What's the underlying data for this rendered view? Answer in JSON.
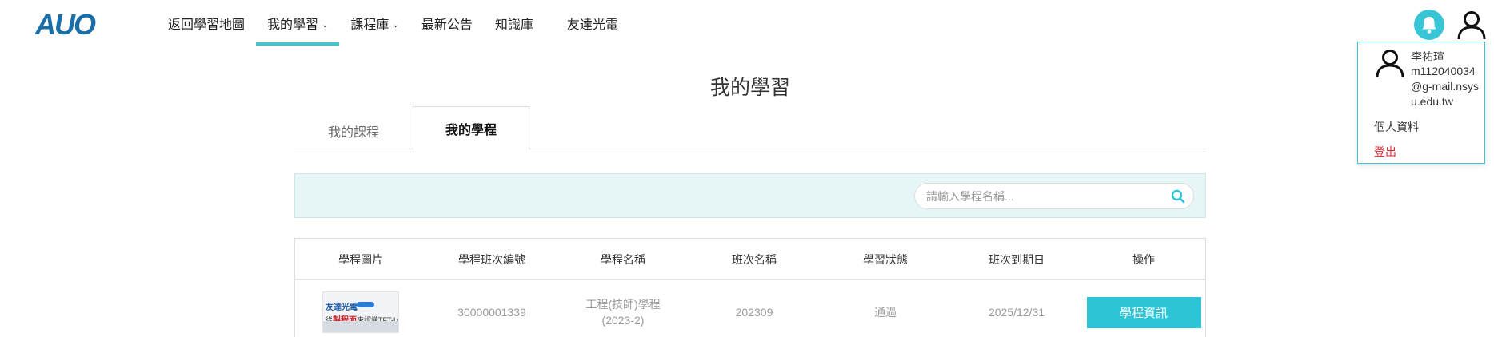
{
  "header": {
    "logo_text": "AUO",
    "nav": [
      {
        "label": "返回學習地圖",
        "has_dropdown": false,
        "active": false
      },
      {
        "label": "我的學習",
        "has_dropdown": true,
        "active": true
      },
      {
        "label": "課程庫",
        "has_dropdown": true,
        "active": false
      },
      {
        "label": "最新公告",
        "has_dropdown": false,
        "active": false
      },
      {
        "label": "知識庫",
        "has_dropdown": false,
        "active": false
      },
      {
        "label": "友達光電",
        "has_dropdown": false,
        "active": false
      }
    ],
    "icons": {
      "bell": "bell-icon",
      "user": "user-icon"
    }
  },
  "user_menu": {
    "name": "李祐瑄",
    "email": "m112040034@g-mail.nsysu.edu.tw",
    "profile_label": "個人資料",
    "logout_label": "登出"
  },
  "page": {
    "title": "我的學習",
    "tabs": [
      {
        "label": "我的課程",
        "active": false
      },
      {
        "label": "我的學程",
        "active": true
      }
    ]
  },
  "search": {
    "value": "",
    "placeholder": "請輸入學程名稱..."
  },
  "table": {
    "headers": [
      "學程圖片",
      "學程班次編號",
      "學程名稱",
      "班次名稱",
      "學習狀態",
      "班次到期日",
      "操作"
    ],
    "rows": [
      {
        "thumbnail": {
          "line1": "友達光電",
          "line2_prefix": "從",
          "line2_highlight": "製程面",
          "line2_suffix": "來認識TFT-LCD"
        },
        "class_id": "30000001339",
        "program_name": "工程(技師)學程(2023-2)",
        "class_name": "202309",
        "status": "通過",
        "expiry": "2025/12/31",
        "action_label": "學程資訊"
      }
    ]
  },
  "colors": {
    "accent": "#3cc6d3",
    "button": "#2cc4d6",
    "logo": "#1a6fa8",
    "search_bg": "#e6f5f5",
    "logout": "#e0252e"
  }
}
